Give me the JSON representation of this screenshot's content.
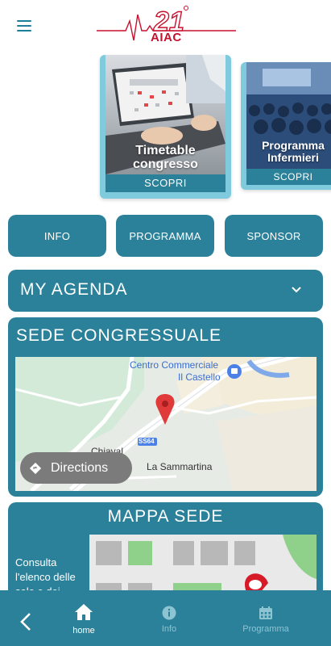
{
  "header": {
    "logo_number": "21",
    "logo_text": "AIAC",
    "menu_icon": "hamburger-menu-icon",
    "brand_color": "#c8102e",
    "accent_color": "#1f7f96"
  },
  "carousel": [
    {
      "title": "Timetable congresso",
      "button": "SCOPRI"
    },
    {
      "title": "Programma Infermieri",
      "button": "SCOPRI"
    }
  ],
  "quick_links": {
    "info": "INFO",
    "programma": "PROGRAMMA",
    "sponsor": "SPONSOR"
  },
  "agenda": {
    "title": "MY AGENDA",
    "chevron_icon": "chevron-down-icon"
  },
  "venue": {
    "title": "SEDE CONGRESSUALE",
    "map": {
      "place_label": "Centro Commerciale Il Castello",
      "place_label_line1": "Centro Commerciale",
      "place_label_line2": "Il Castello",
      "road_label": "SS64",
      "area_label": "La Sammartina",
      "partial_label": "Chiaval"
    },
    "directions_label": "Directions"
  },
  "site_map": {
    "title": "MAPPA SEDE",
    "description": "Consulta l'elenco delle sale e dei"
  },
  "bottom_nav": {
    "back_icon": "back-arrow-icon",
    "items": [
      {
        "label": "home",
        "icon": "home-icon",
        "active": true
      },
      {
        "label": "Info",
        "icon": "info-icon",
        "active": false
      },
      {
        "label": "Programma",
        "icon": "calendar-icon",
        "active": false
      }
    ]
  }
}
